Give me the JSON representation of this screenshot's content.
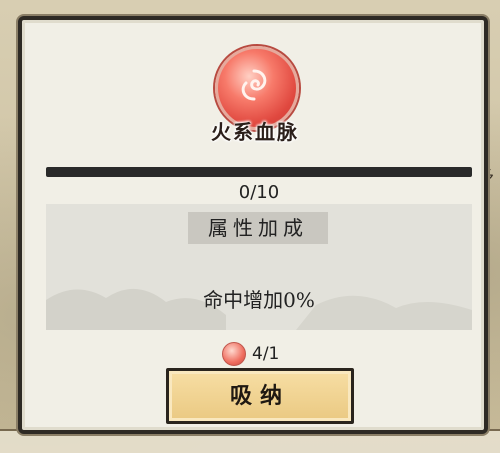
{
  "panel": {
    "bloodline_name": "火系血脉",
    "progress": {
      "text": "0/10",
      "fill_fraction": 0.0
    },
    "bonus": {
      "title": "属性加成",
      "stat_text": "命中增加0%"
    },
    "cost": {
      "icon": "fire-orb-icon",
      "text": "4/1"
    },
    "absorb_button_label": "吸纳"
  },
  "colors": {
    "accent_orb": "#e0483f",
    "button_bg": "#eac982"
  }
}
